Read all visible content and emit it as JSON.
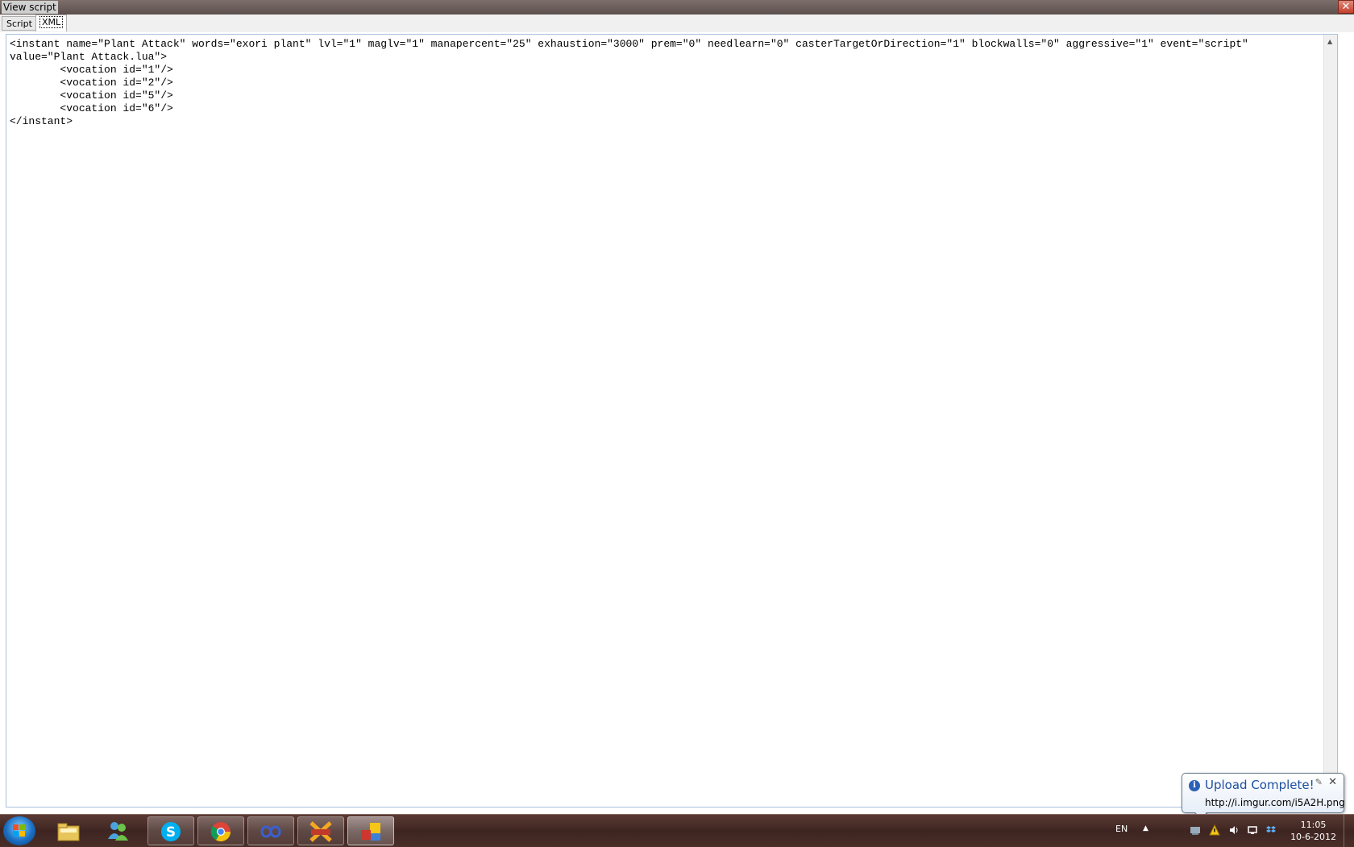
{
  "window": {
    "title": "View script",
    "close_glyph": "✕"
  },
  "tabs": [
    {
      "label": "Script",
      "active": false
    },
    {
      "label": "XML",
      "active": true
    }
  ],
  "editor": {
    "lines": [
      "<instant name=\"Plant Attack\" words=\"exori plant\" lvl=\"1\" maglv=\"1\" manapercent=\"25\" exhaustion=\"3000\" prem=\"0\" needlearn=\"0\" casterTargetOrDirection=\"1\" blockwalls=\"0\" aggressive=\"1\" event=\"script\"",
      "value=\"Plant Attack.lua\">",
      "        <vocation id=\"1\"/>",
      "        <vocation id=\"2\"/>",
      "        <vocation id=\"5\"/>",
      "        <vocation id=\"6\"/>",
      "</instant>"
    ]
  },
  "taskbar": {
    "start_icon": "windows-start-orb",
    "items": [
      {
        "name": "windows-explorer-icon",
        "state": "pinned"
      },
      {
        "name": "messenger-icon",
        "state": "pinned"
      },
      {
        "name": "skype-icon",
        "state": "running"
      },
      {
        "name": "chrome-icon",
        "state": "running"
      },
      {
        "name": "infinity-app-icon",
        "state": "running"
      },
      {
        "name": "chat-app-icon",
        "state": "running"
      },
      {
        "name": "window-app-icon",
        "state": "active"
      }
    ],
    "tray": {
      "language": "EN",
      "icons": [
        "network-icon",
        "warning-icon",
        "volume-icon",
        "action-center-icon",
        "dropbox-icon"
      ]
    },
    "clock": {
      "time": "11:05",
      "date": "10-6-2012"
    }
  },
  "notification": {
    "title": "Upload Complete!",
    "message": "http://i.imgur.com/i5A2H.png",
    "info_glyph": "i",
    "close_glyph": "✕",
    "options_glyph": "✎"
  },
  "colors": {
    "balloon_title": "#1e4fa0",
    "taskbar": "#4a2e28",
    "editor_border": "#a9c1dd"
  }
}
